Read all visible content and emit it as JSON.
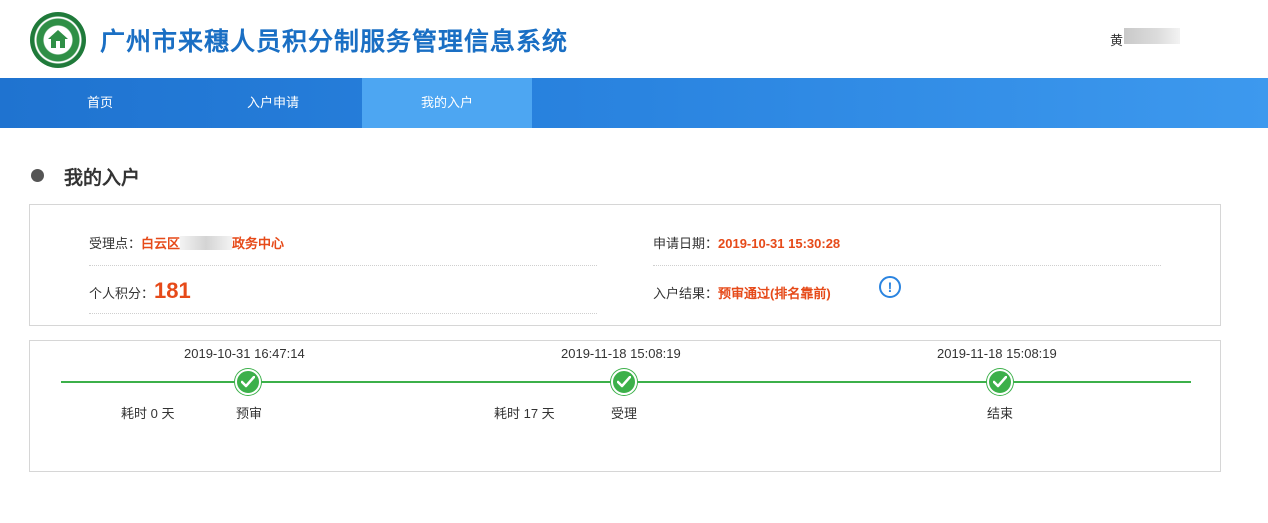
{
  "header": {
    "site_title": "广州市来穗人员积分制服务管理信息系统",
    "user_name": "黄"
  },
  "nav": {
    "items": [
      {
        "label": "首页"
      },
      {
        "label": "入户申请"
      },
      {
        "label": "我的入户",
        "active": true
      }
    ]
  },
  "section": {
    "title": "我的入户"
  },
  "info": {
    "acceptance_point_label": "受理点：",
    "acceptance_point_value_start": "白云区",
    "acceptance_point_value_end": "政务中心",
    "apply_date_label": "申请日期：",
    "apply_date_value": "2019-10-31 15:30:28",
    "score_label": "个人积分：",
    "score_value": "181",
    "result_label": "入户结果：",
    "result_value": "预审通过(排名靠前)",
    "info_icon_glyph": "!"
  },
  "timeline": {
    "line_color": "#3cb04a",
    "steps": [
      {
        "date": "2019-10-31 16:47:14",
        "label": "预审",
        "duration": "耗时 0 天"
      },
      {
        "date": "2019-11-18 15:08:19",
        "label": "受理",
        "duration": "耗时 17 天"
      },
      {
        "date": "2019-11-18 15:08:19",
        "label": "结束",
        "duration": ""
      }
    ]
  },
  "colors": {
    "brand_blue": "#1a6fc4",
    "nav_blue": "#2a84e0",
    "accent_red": "#e64a19",
    "success_green": "#3cb04a"
  }
}
